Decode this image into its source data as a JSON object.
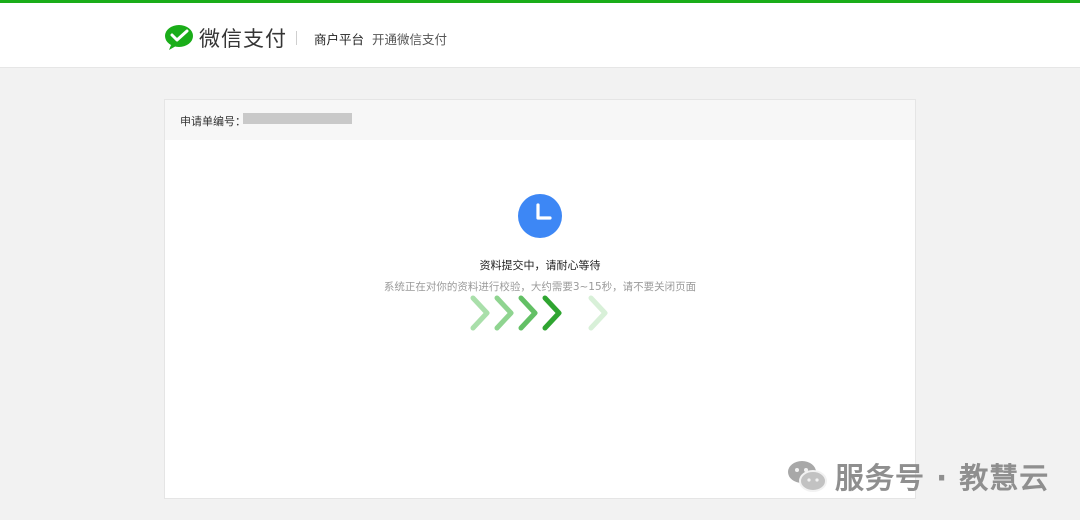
{
  "header": {
    "brand": "微信支付",
    "nav_merchant": "商户平台",
    "nav_open": "开通微信支付",
    "accent_color": "#1aad19"
  },
  "application": {
    "number_label": "申请单编号：",
    "number_value_state": "redacted"
  },
  "status": {
    "icon": "clock-icon",
    "title": "资料提交中，请耐心等待",
    "description": "系统正在对你的资料进行校验，大约需要3~15秒，请不要关闭页面",
    "progress_icon": "chevron-progress-icon"
  },
  "watermark": {
    "icon": "wechat-icon",
    "text": "服务号 · 教慧云"
  }
}
